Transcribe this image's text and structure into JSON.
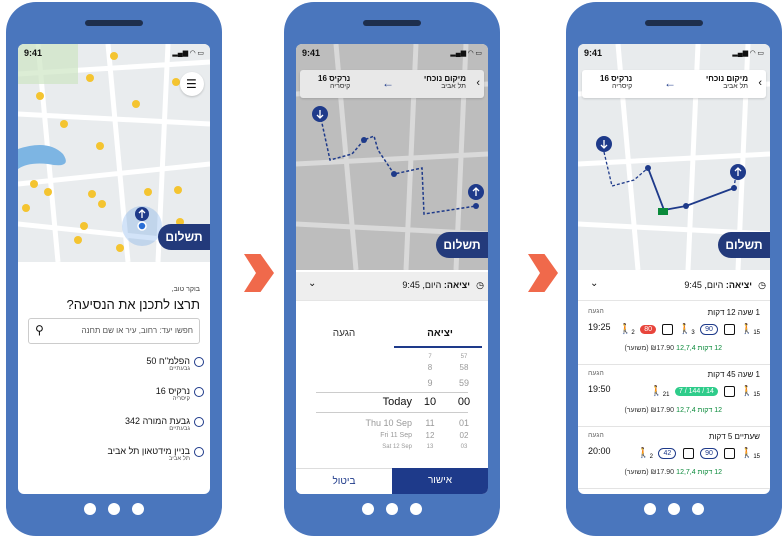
{
  "status": {
    "time": "9:41"
  },
  "pay_label": "תשלום",
  "phone1": {
    "greeting": "בוקר טוב,",
    "question": "תרצו לתכנן את הנסיעה?",
    "search_placeholder": "חפשו יעד: רחוב, עיר או שם תחנה",
    "history": [
      {
        "title": "הפלמ\"ח 50",
        "sub": "גבעתיים"
      },
      {
        "title": "נרקיס 16",
        "sub": "קיסריה"
      },
      {
        "title": "גבעת המורה 342",
        "sub": "גבעתיים"
      },
      {
        "title": "בניין מידטאון תל אביב",
        "sub": "תל אביב"
      }
    ]
  },
  "route": {
    "from_title": "מיקום נוכחי",
    "from_sub": "תל אביב",
    "to_title": "נרקיס 16",
    "to_sub": "קיסריה"
  },
  "departure": {
    "label": "יציאה:",
    "value": "היום, 9:45"
  },
  "phone2": {
    "tab_departure": "יציאה",
    "tab_arrival": "הגעה",
    "picker_days": [
      "Today",
      "Thu 10 Sep",
      "Fri 11 Sep",
      "Sat 12 Sep"
    ],
    "picker_hours_above": [
      "7",
      "8",
      "9"
    ],
    "picker_hour_selected": "10",
    "picker_hours_below": [
      "11",
      "12",
      "13"
    ],
    "picker_minutes_above": [
      "57",
      "58",
      "59"
    ],
    "picker_minute_selected": "00",
    "picker_minutes_below": [
      "01",
      "02",
      "03"
    ],
    "cancel_label": "ביטול",
    "ok_label": "אישור"
  },
  "phone3": {
    "arrival_label": "הגעה",
    "results": [
      {
        "duration": "1 שעה 12 דקות",
        "arrive": "19:25",
        "walk": "12 דקות",
        "lines": "12,7,4",
        "price": "₪17.90 (משוער)",
        "badges": [
          "80",
          "90"
        ],
        "walk_steps": [
          "2",
          "3",
          "15"
        ]
      },
      {
        "duration": "1 שעה 45 דקות",
        "arrive": "19:50",
        "walk": "12 דקות",
        "lines": "12,7,4",
        "price": "₪17.90 (משוער)",
        "badges": [
          "7 / 144 / 14"
        ],
        "walk_steps": [
          "21",
          "15"
        ]
      },
      {
        "duration": "שעתיים 5 דקות",
        "arrive": "20:00",
        "walk": "12 דקות",
        "lines": "12,7,4",
        "price": "₪17.90 (משוער)",
        "badges": [
          "42",
          "90"
        ],
        "walk_steps": [
          "2",
          "15"
        ]
      }
    ]
  },
  "colors": {
    "phone": "#4a76bd",
    "accent": "#1e3a8a",
    "arrow": "#f0694b",
    "walk": "#0a8a3a"
  }
}
